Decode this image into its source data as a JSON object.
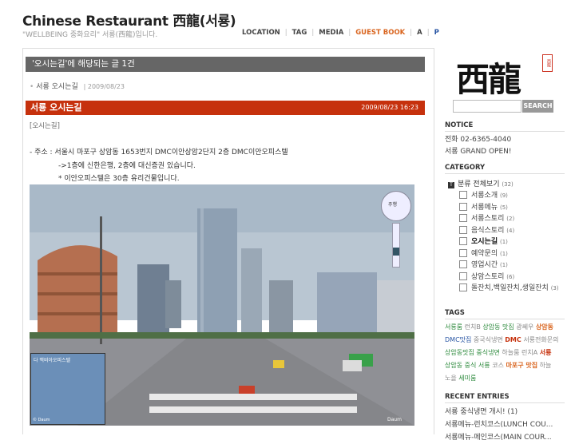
{
  "site": {
    "title": "Chinese Restaurant 西龍(서룡)",
    "description": "\"WELLBEING 중화요리\" 서룡(西龍)입니다."
  },
  "nav": {
    "location": "LOCATION",
    "tag": "TAG",
    "media": "MEDIA",
    "guestbook": "GUEST BOOK",
    "a": "A",
    "p": "P",
    "sep": "|"
  },
  "main": {
    "search_heading": "'오시는길'에  해당되는  글  1건",
    "result_title": "서룡 오시는길",
    "result_date": "| 2009/08/23",
    "post_title": "서룡  오시는길",
    "post_datetime": "2009/08/23 16:23",
    "post_category": "[오시는길]",
    "lines": [
      "- 주소 : 서울시 마포구 상암동 1653번지 DMC이안상암2단지 2층 DMC이안오피스텔",
      "->1층에 신한은행, 2층에 대신증권 있습니다.",
      "* 이안오피스텔은 30층 유리건물입니다."
    ],
    "map_label": "다 맥비아오피스텔",
    "map_logo": "© Daum",
    "compass_label": "주행",
    "view_tag": "Daum"
  },
  "sidebar": {
    "logo_text": "西龍",
    "seal_text": "西龍",
    "search_button": "SEARCH",
    "search_placeholder": "",
    "notice_heading": "NOTICE",
    "notice_lines": [
      "전화 02-6365-4040",
      "서룡 GRAND OPEN!"
    ],
    "category_heading": "CATEGORY",
    "category_root": "분류 전체보기",
    "category_root_count": "(32)",
    "categories": [
      {
        "name": "서룡소개",
        "count": "(9)"
      },
      {
        "name": "서룡메뉴",
        "count": "(5)"
      },
      {
        "name": "서룡스토리",
        "count": "(2)"
      },
      {
        "name": "음식스토리",
        "count": "(4)"
      },
      {
        "name": "오시는길",
        "count": "(1)"
      },
      {
        "name": "예약문의",
        "count": "(1)"
      },
      {
        "name": "영업시간",
        "count": "(1)"
      },
      {
        "name": "상암스토리",
        "count": "(6)"
      },
      {
        "name": "돌잔치,백일잔치,생일잔치",
        "count": "(3)"
      }
    ],
    "tags_heading": "TAGS",
    "tags": [
      {
        "text": "서룡룸",
        "cls": "t2"
      },
      {
        "text": "런치B",
        "cls": "t5"
      },
      {
        "text": "상암동 맛집",
        "cls": "t2"
      },
      {
        "text": "광쎄우",
        "cls": "t5"
      },
      {
        "text": "상암동",
        "cls": "t1"
      },
      {
        "text": "DMC맛집",
        "cls": "t3"
      },
      {
        "text": "중국식냉면",
        "cls": "t5"
      },
      {
        "text": "DMC",
        "cls": "t4"
      },
      {
        "text": "서룡전화문의",
        "cls": "t5"
      },
      {
        "text": "상암동맛집",
        "cls": "t2"
      },
      {
        "text": "중식냉면",
        "cls": "t2"
      },
      {
        "text": "하늘룸",
        "cls": "t5"
      },
      {
        "text": "런치A",
        "cls": "t5"
      },
      {
        "text": "서룡",
        "cls": "t4"
      },
      {
        "text": "상암동",
        "cls": "t2"
      },
      {
        "text": "중식",
        "cls": "t2"
      },
      {
        "text": "서룡",
        "cls": "t2"
      },
      {
        "text": "코스",
        "cls": "t5"
      },
      {
        "text": "마포구 맛집",
        "cls": "t1"
      },
      {
        "text": "하늘",
        "cls": "t5"
      },
      {
        "text": "노을",
        "cls": "t5"
      },
      {
        "text": "세미룸",
        "cls": "t2"
      }
    ],
    "recent_heading": "RECENT ENTRIES",
    "recent": [
      "서룡 중식냉면 개시! (1)",
      "서룡메뉴-런치코스(LUNCH COU...",
      "서룡메뉴-메인코스(MAIN COUR..."
    ]
  }
}
